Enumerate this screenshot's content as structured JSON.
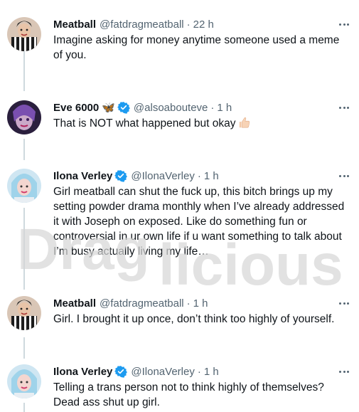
{
  "tweets": [
    {
      "name": "Meatball",
      "handle": "@fatdragmeatball",
      "time": "22 h",
      "text": "Imagine asking for money anytime someone used a meme of you.",
      "verified": false
    },
    {
      "name": "Eve 6000",
      "emoji": "🦋",
      "handle": "@alsoabouteve",
      "time": "1 h",
      "text": "That is NOT what happened but okay",
      "verified": true
    },
    {
      "name": "Ilona Verley",
      "handle": "@IlonaVerley",
      "time": "1 h",
      "text": "Girl meatball can shut the fuck up, this bitch brings up my setting powder drama monthly when I’ve already addressed it with Joseph on exposed. Like do something fun or controversial in ur own life if u want something to talk about I’m busy actually living my life…",
      "verified": true
    },
    {
      "name": "Meatball",
      "handle": "@fatdragmeatball",
      "time": "1 h",
      "text": "Girl. I brought it up once, don’t think too highly of yourself.",
      "verified": false
    },
    {
      "name": "Ilona Verley",
      "handle": "@IlonaVerley",
      "time": "1 h",
      "text": "Telling a trans person not to think highly of themselves? Dead ass shut up girl.",
      "verified": true
    }
  ],
  "separator": "·",
  "watermark": {
    "part1": "Drag",
    "part2": "licious"
  },
  "colors": {
    "text": "#0f1419",
    "secondary": "#536471",
    "verified": "#1d9bf0",
    "thread_line": "#cfd9de",
    "watermark": "#d9d9d9"
  }
}
